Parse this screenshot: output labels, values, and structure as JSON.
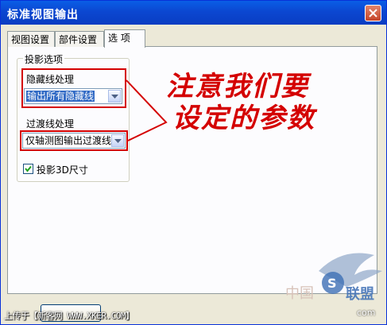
{
  "window": {
    "title": "标准视图输出"
  },
  "tabs": [
    {
      "label": "视图设置"
    },
    {
      "label": "部件设置"
    },
    {
      "label": "选  项"
    }
  ],
  "projection_group": {
    "label": "投影选项",
    "hidden_line": {
      "label": "隐藏线处理",
      "selected_value": "输出所有隐藏线"
    },
    "transition_line": {
      "label": "过渡线处理",
      "selected_value": "仅轴测图输出过渡线"
    },
    "dim3d": {
      "label": "投影3D尺寸",
      "checked": true
    }
  },
  "annotation": {
    "line1": "注意我们要",
    "line2": "设定的参数",
    "color": "#d40000"
  },
  "footer": {
    "upload_text": "上传于【新客网 WWW.XKER.COM】",
    "watermark": "中国",
    "watermark_url": "com"
  },
  "colors": {
    "titlebar": "#0b47d1",
    "dialog_bg": "#ece9d8",
    "highlight": "#316ac5"
  }
}
